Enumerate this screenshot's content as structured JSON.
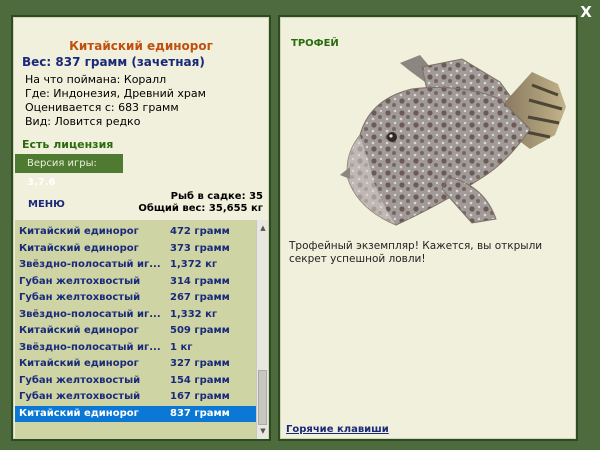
{
  "window": {
    "close_label": "X"
  },
  "fish_info": {
    "name": "Китайский единорог",
    "weight_line": "Вес: 837 грамм (зачетная)",
    "lines": [
      "На что поймана: Коралл",
      "Где: Индонезия, Древний храм",
      "Оценивается с: 683 грамм",
      "Вид: Ловится редко"
    ]
  },
  "license_label": "Есть лицензия",
  "version": {
    "prefix": "Версия игры: ",
    "number": "3.7.6"
  },
  "menu_label": "меню",
  "stats": {
    "fish_in_keepnet": "Рыб в садке: 35",
    "total_weight": "Общий вес: 35,655 кг"
  },
  "catch_list": [
    {
      "name": "Китайский единорог",
      "weight": "472 грамм"
    },
    {
      "name": "Китайский единорог",
      "weight": "373 грамм"
    },
    {
      "name": "Звёздно-полосатый иг...",
      "weight": "1,372 кг"
    },
    {
      "name": "Губан желтохвостый",
      "weight": "314 грамм"
    },
    {
      "name": "Губан желтохвостый",
      "weight": "267 грамм"
    },
    {
      "name": "Звёздно-полосатый иг...",
      "weight": "1,332 кг"
    },
    {
      "name": "Китайский единорог",
      "weight": "509 грамм"
    },
    {
      "name": "Звёздно-полосатый иг...",
      "weight": "1 кг"
    },
    {
      "name": "Китайский единорог",
      "weight": "327 грамм"
    },
    {
      "name": "Губан желтохвостый",
      "weight": "154 грамм"
    },
    {
      "name": "Губан желтохвостый",
      "weight": "167 грамм"
    },
    {
      "name": "Китайский единорог",
      "weight": "837 грамм"
    }
  ],
  "selected_index": 11,
  "trophy": {
    "title": "ТРОФЕЙ",
    "message": "Трофейный экземпляр! Кажется, вы открыли секрет успешной ловли!"
  },
  "hotkeys_label": "Горячие клавиши",
  "icons": {
    "close": "close-icon",
    "scroll_up": "chevron-up-icon",
    "scroll_down": "chevron-down-icon"
  },
  "colors": {
    "background": "#4d6b3c",
    "panel": "#f0f0dc",
    "fish_name": "#c05010",
    "link": "#1a2a7a",
    "selection": "#0a78d4"
  }
}
